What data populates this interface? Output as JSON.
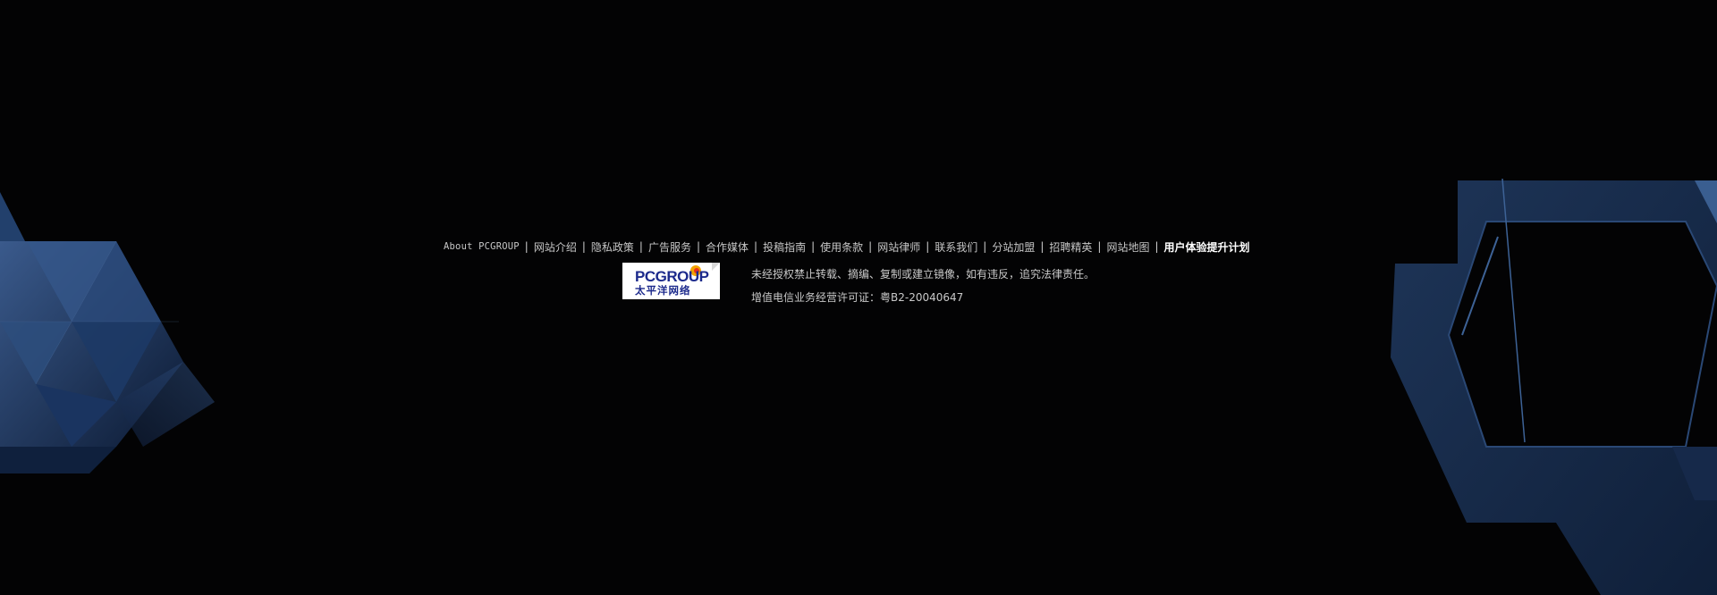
{
  "footer": {
    "links": [
      {
        "label": "About PCGROUP"
      },
      {
        "label": "网站介绍"
      },
      {
        "label": "隐私政策"
      },
      {
        "label": "广告服务"
      },
      {
        "label": "合作媒体"
      },
      {
        "label": "投稿指南"
      },
      {
        "label": "使用条款"
      },
      {
        "label": "网站律师"
      },
      {
        "label": "联系我们"
      },
      {
        "label": "分站加盟"
      },
      {
        "label": "招聘精英"
      },
      {
        "label": "网站地图"
      },
      {
        "label": "用户体验提升计划"
      }
    ],
    "separator": "|"
  },
  "logo": {
    "brand_text": "PCGROUP",
    "cn_text": "太平洋网络"
  },
  "copyright": {
    "notice": "未经授权禁止转载、摘编、复制或建立镜像，如有违反，追究法律责任。",
    "license": "增值电信业务经营许可证：粤B2-20040647"
  },
  "colors": {
    "background": "#030304",
    "deco_blue": "#1f3a63",
    "logo_blue": "#1c2a8c",
    "link_text": "#c7c7c7"
  }
}
